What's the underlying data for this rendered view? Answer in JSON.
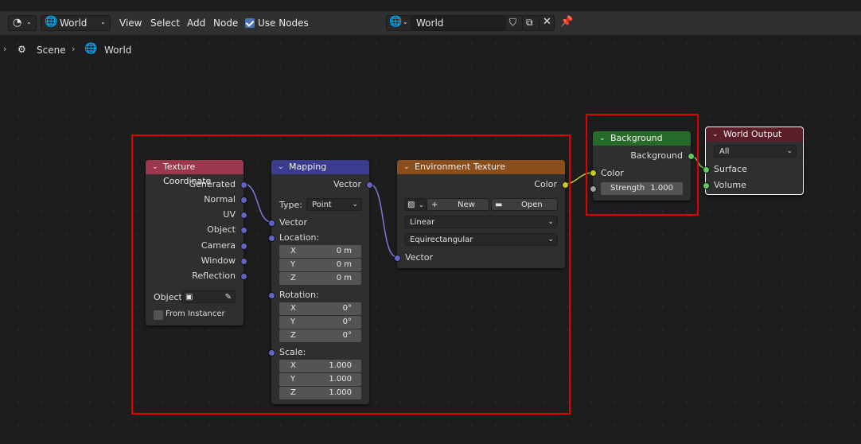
{
  "header": {
    "editor_type_icon": "node-editor-icon",
    "world_menu": "World",
    "menus": [
      "View",
      "Select",
      "Add",
      "Node"
    ],
    "use_nodes_label": "Use Nodes",
    "use_nodes_checked": true,
    "datablock_name": "World"
  },
  "breadcrumb": {
    "scene": "Scene",
    "world": "World"
  },
  "nodes": {
    "texture_coordinate": {
      "title": "Texture Coordinate",
      "color": "#9c3750",
      "outputs": [
        "Generated",
        "Normal",
        "UV",
        "Object",
        "Camera",
        "Window",
        "Reflection"
      ],
      "object_label": "Object:",
      "from_instancer": "From Instancer"
    },
    "mapping": {
      "title": "Mapping",
      "color": "#3b3b8f",
      "output": "Vector",
      "type_label": "Type:",
      "type_value": "Point",
      "vector_input": "Vector",
      "location_label": "Location:",
      "location": [
        {
          "axis": "X",
          "value": "0 m"
        },
        {
          "axis": "Y",
          "value": "0 m"
        },
        {
          "axis": "Z",
          "value": "0 m"
        }
      ],
      "rotation_label": "Rotation:",
      "rotation": [
        {
          "axis": "X",
          "value": "0°"
        },
        {
          "axis": "Y",
          "value": "0°"
        },
        {
          "axis": "Z",
          "value": "0°"
        }
      ],
      "scale_label": "Scale:",
      "scale": [
        {
          "axis": "X",
          "value": "1.000"
        },
        {
          "axis": "Y",
          "value": "1.000"
        },
        {
          "axis": "Z",
          "value": "1.000"
        }
      ]
    },
    "environment_texture": {
      "title": "Environment Texture",
      "color": "#8a4d1c",
      "output": "Color",
      "new_label": "New",
      "open_label": "Open",
      "interpolation": "Linear",
      "projection": "Equirectangular",
      "vector_input": "Vector"
    },
    "background": {
      "title": "Background",
      "color": "#266b2a",
      "output": "Background",
      "color_input": "Color",
      "strength_label": "Strength",
      "strength_value": "1.000"
    },
    "world_output": {
      "title": "World Output",
      "color": "#5a1f2a",
      "target": "All",
      "surface": "Surface",
      "volume": "Volume"
    }
  },
  "colors": {
    "vector_socket": "#6363c7",
    "color_socket": "#c7c729",
    "shader_socket": "#63c763",
    "highlight": "#e00000"
  }
}
